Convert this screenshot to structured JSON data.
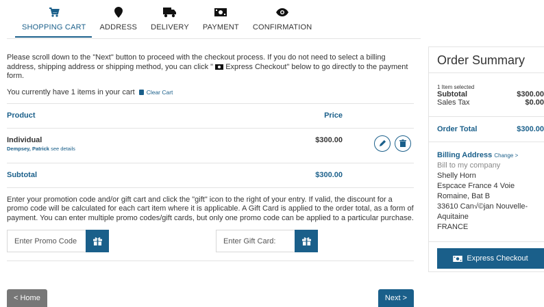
{
  "steps": [
    {
      "label": "SHOPPING CART",
      "icon": "cart-icon"
    },
    {
      "label": "ADDRESS",
      "icon": "map-pin-icon"
    },
    {
      "label": "DELIVERY",
      "icon": "truck-icon"
    },
    {
      "label": "PAYMENT",
      "icon": "money-icon"
    },
    {
      "label": "CONFIRMATION",
      "icon": "eye-icon"
    }
  ],
  "intro": "Please scroll down to the \"Next\" button to  proceed with the checkout process.  If you do not need to select a billing address, shipping address or shipping method, you can click \" Express Checkout\" below to go directly to the payment form.",
  "intro_parts": {
    "before": "Please scroll down to the \"Next\" button to  proceed with the checkout process.  If you do not need to select a billing address, shipping address or shipping method, you can click \" ",
    "after": " Express Checkout\" below to go directly to the payment form."
  },
  "cart": {
    "count_text": "You currently have 1 items in your cart",
    "clear_label": "Clear Cart"
  },
  "table": {
    "product_header": "Product",
    "price_header": "Price",
    "item": {
      "name": "Individual",
      "customer": "Dempsey, Patrick",
      "details_link": "see details",
      "price": "$300.00"
    },
    "subtotal_label": "Subtotal",
    "subtotal_value": "$300.00"
  },
  "promo": {
    "text": "Enter your promotion code and/or gift cart and click the \"gift\" icon to the right of your entry. If valid, the discount for a promo code will be calculated for each cart item where it is applicable. A Gift Card is applied to the order total, as a form of payment. You can enter multiple promo codes/gift cards, but only one promo code can be applied to a particular purchase.",
    "promo_placeholder": "Enter Promo Code",
    "gift_placeholder": "Enter Gift Card:"
  },
  "nav": {
    "home_label": "< Home",
    "next_label": "Next >"
  },
  "summary": {
    "title": "Order Summary",
    "items_selected": "1 Item selected",
    "subtotal_label": "Subtotal",
    "subtotal_value": "$300.00",
    "tax_label": "Sales Tax",
    "tax_value": "$0.00",
    "total_label": "Order Total",
    "total_value": "$300.00",
    "billing_heading": "Billing Address",
    "change_label": "Change >",
    "billing_lines": [
      "Bill to my company",
      "Shelly Horn",
      "Espcace France 4 Voie",
      "Romaine, Bat B",
      "33610 Can√©jan Nouvelle-",
      "Aquitaine",
      "FRANCE"
    ],
    "express_label": "Express Checkout"
  },
  "colors": {
    "accent": "#1a5f8a",
    "home_button": "#777777",
    "text": "#333333"
  }
}
